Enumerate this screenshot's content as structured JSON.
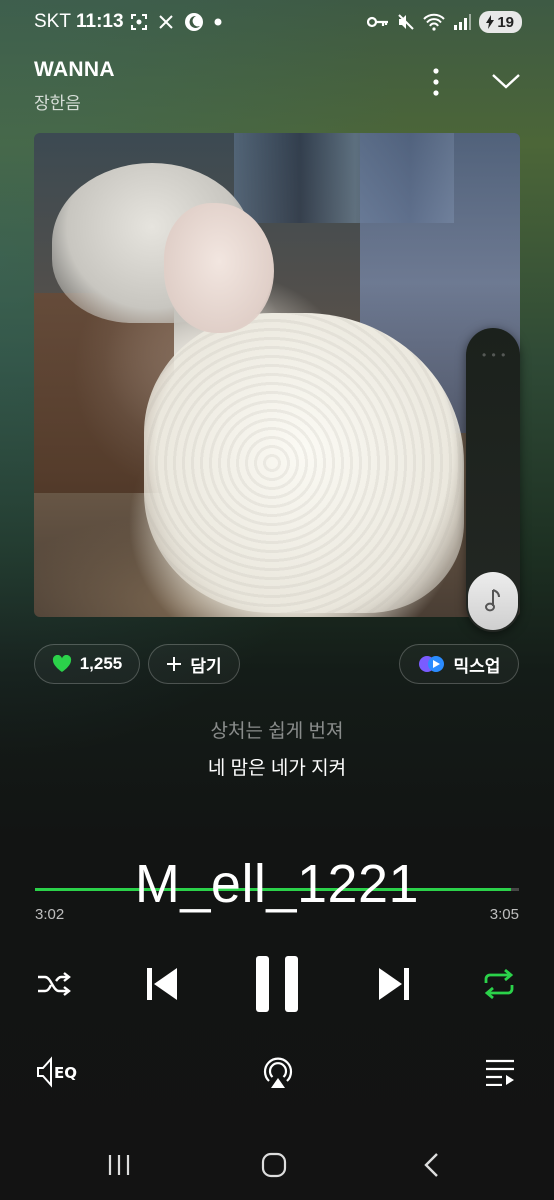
{
  "status_bar": {
    "carrier": "SKT",
    "time": "11:13",
    "battery": "19",
    "left_icons": [
      "screenshot-icon",
      "x-twitter-icon",
      "moon-icon",
      "dot-icon"
    ],
    "right_icons": [
      "key-icon",
      "mute-icon",
      "wifi-icon",
      "signal-icon",
      "battery-icon"
    ]
  },
  "header": {
    "title": "WANNA",
    "artist": "장한음"
  },
  "actions": {
    "like_count": "1,255",
    "add_label": "담기",
    "mixup_label": "믹스업"
  },
  "lyrics": {
    "previous": "상처는 쉽게 번져",
    "current": "네 맘은 네가 지켜"
  },
  "watermark": "M_ell_1221",
  "progress": {
    "current": "3:02",
    "total": "3:05",
    "fraction": 0.9837
  },
  "colors": {
    "accent": "#2bd24a",
    "background_top": "#4c6638",
    "background_bottom": "#131313"
  }
}
